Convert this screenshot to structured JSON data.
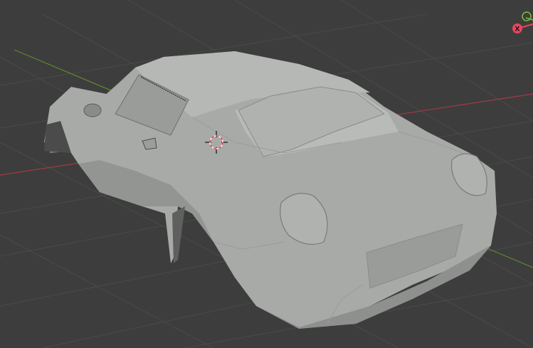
{
  "viewport": {
    "background": "#3d3d3d",
    "grid_color": "#4a4a4a",
    "x_axis_color": "#a33a45",
    "y_axis_color": "#5c8a2e"
  },
  "model": {
    "name_icon": "car-body-mesh",
    "base_color": "#a8aaa8",
    "shade_color": "#8e908e",
    "highlight_color": "#c4c6c4"
  },
  "cursor": {
    "icon": "3d-cursor-icon",
    "ring_color_a": "#e04040",
    "ring_color_b": "#f0f0f0"
  },
  "nav_gizmo": {
    "x_label": "X",
    "x_color": "#e8455c",
    "y_color": "#7cbf3a"
  }
}
